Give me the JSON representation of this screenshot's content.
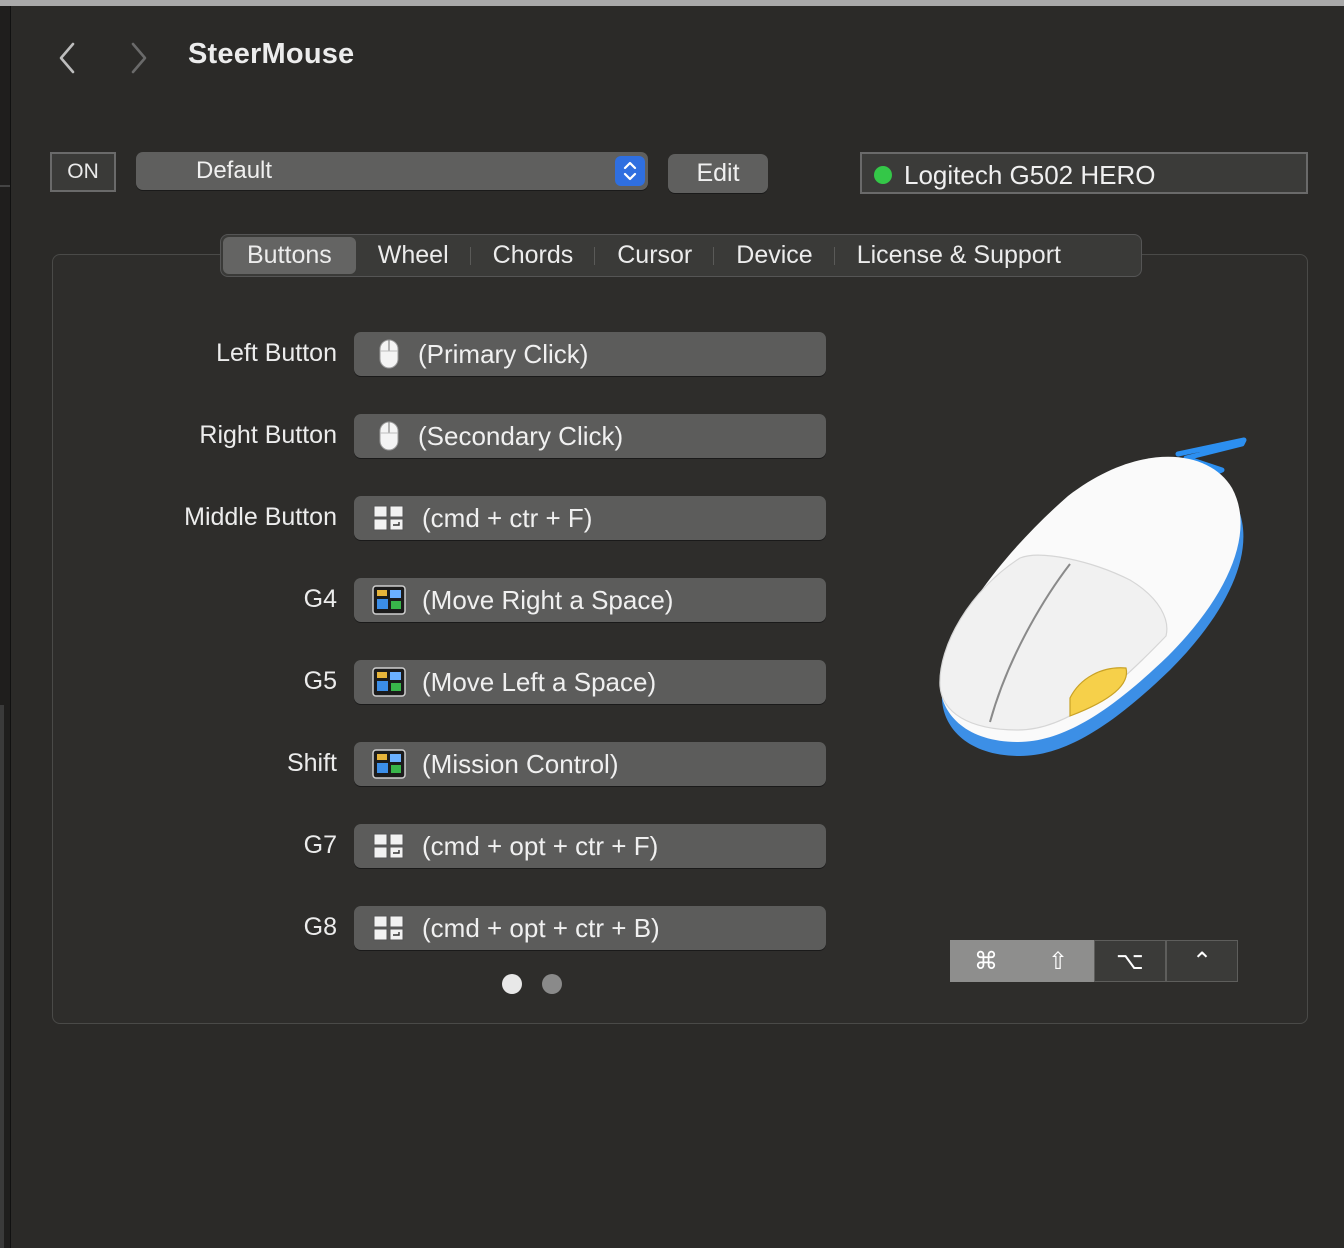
{
  "window": {
    "title": "SteerMouse",
    "back_label": "‹",
    "forward_label": "›"
  },
  "toolbar": {
    "on_label": "ON",
    "preset_value": "Default",
    "edit_label": "Edit",
    "device_name": "Logitech G502 HERO",
    "device_status_color": "#34c748"
  },
  "tabs": [
    {
      "label": "Buttons",
      "selected": true
    },
    {
      "label": "Wheel"
    },
    {
      "label": "Chords"
    },
    {
      "label": "Cursor"
    },
    {
      "label": "Device"
    },
    {
      "label": "License & Support"
    }
  ],
  "button_rows": [
    {
      "label": "Left Button",
      "action": "(Primary Click)",
      "icon": "mouse-icon"
    },
    {
      "label": "Right Button",
      "action": "(Secondary Click)",
      "icon": "mouse-icon"
    },
    {
      "label": "Middle Button",
      "action": "(cmd + ctr + F)",
      "icon": "keyboard-icon"
    },
    {
      "label": "G4",
      "action": "(Move Right a Space)",
      "icon": "mission-control-icon"
    },
    {
      "label": "G5",
      "action": "(Move Left a Space)",
      "icon": "mission-control-icon"
    },
    {
      "label": "Shift",
      "action": "(Mission Control)",
      "icon": "mission-control-icon"
    },
    {
      "label": "G7",
      "action": "(cmd + opt + ctr + F)",
      "icon": "keyboard-icon"
    },
    {
      "label": "G8",
      "action": "(cmd + opt + ctr + B)",
      "icon": "keyboard-icon"
    }
  ],
  "pager": {
    "pages": 2,
    "current": 1
  },
  "modifiers": [
    {
      "symbol": "⌘",
      "name": "command",
      "active": true
    },
    {
      "symbol": "⇧",
      "name": "shift",
      "active": true
    },
    {
      "symbol": "⌥",
      "name": "option",
      "active": false
    },
    {
      "symbol": "⌃",
      "name": "control",
      "active": false
    }
  ],
  "colors": {
    "accent": "#2f6fe0",
    "window_bg": "#2b2a28",
    "field_bg": "#5c5c5b"
  }
}
